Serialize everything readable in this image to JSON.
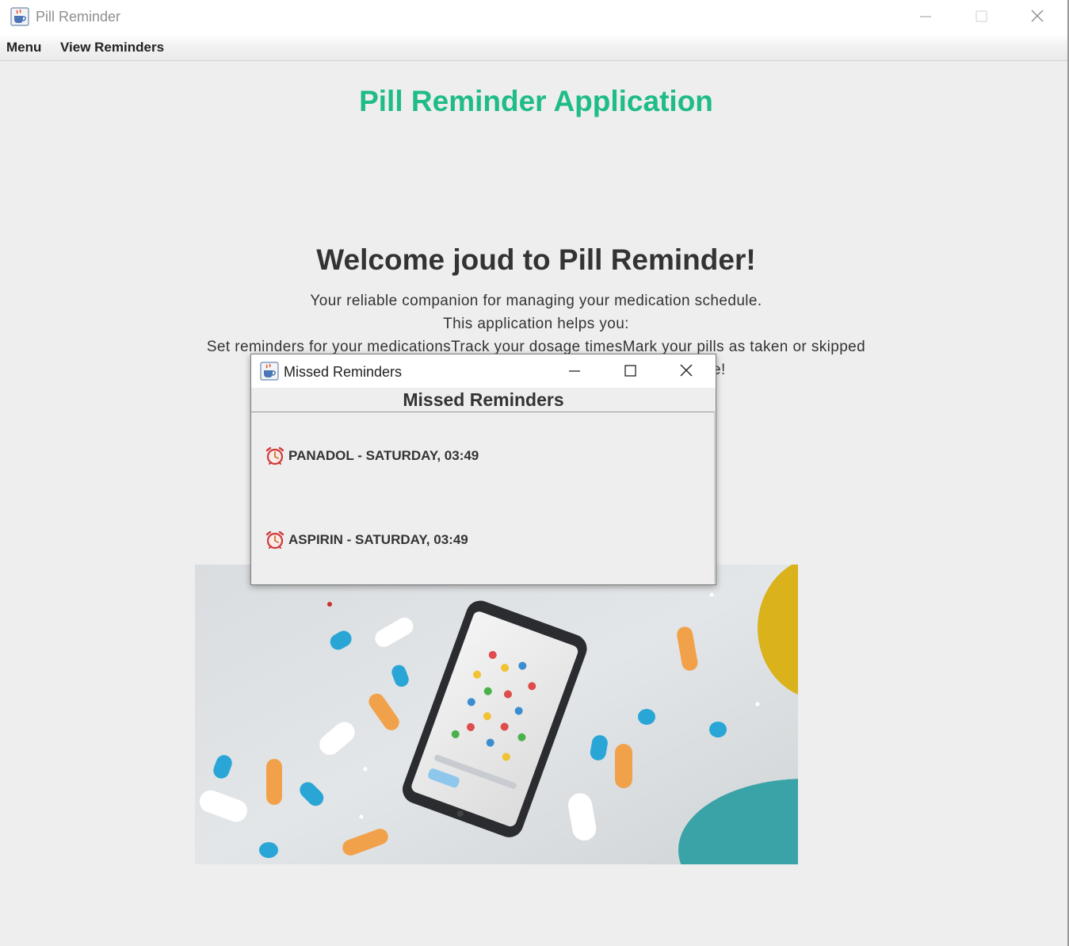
{
  "window": {
    "title": "Pill Reminder",
    "icon": "java-cup-icon"
  },
  "menubar": {
    "items": [
      {
        "label": "Menu"
      },
      {
        "label": "View Reminders"
      }
    ]
  },
  "main": {
    "app_heading": "Pill Reminder Application",
    "welcome": "Welcome joud to Pill Reminder!",
    "lines": [
      "Your reliable companion for managing your medication schedule.",
      "This application helps you:",
      "Set reminders for your medicationsTrack your dosage timesMark your pills as taken or skipped"
    ],
    "partial_line_tail": "e!",
    "colors": {
      "heading": "#1fbc88",
      "background": "#eeeeee"
    },
    "hero_image": "phone-and-pills-photo"
  },
  "dialog": {
    "title": "Missed Reminders",
    "heading": "Missed Reminders",
    "reminders": [
      {
        "icon": "alarm-clock-icon",
        "text": "PANADOL - SATURDAY, 03:49"
      },
      {
        "icon": "alarm-clock-icon",
        "text": "ASPIRIN - SATURDAY, 03:49"
      }
    ]
  }
}
